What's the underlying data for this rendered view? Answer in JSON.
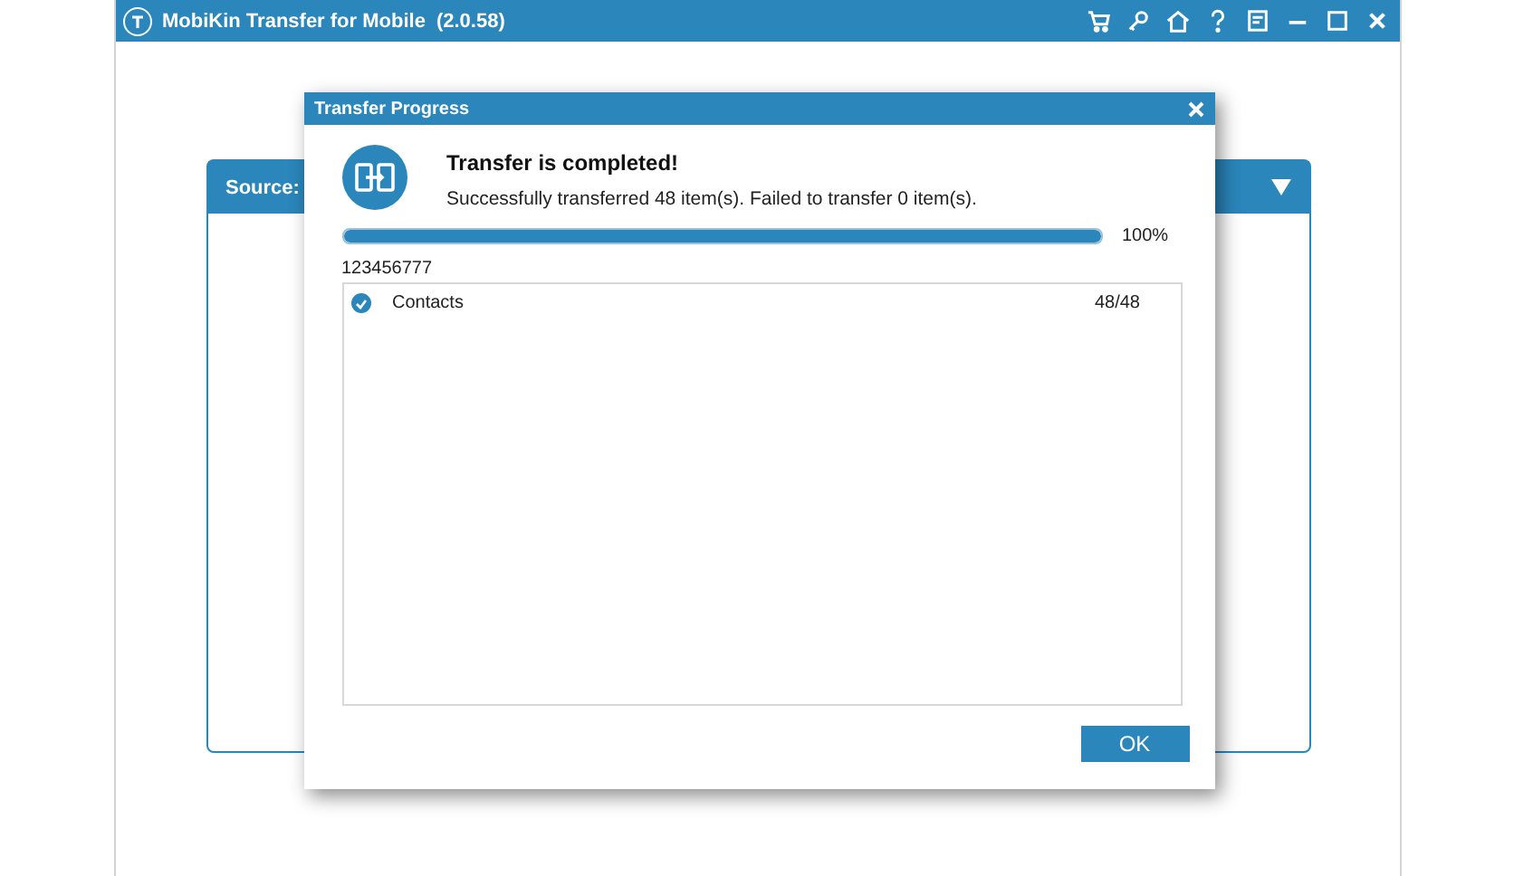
{
  "window": {
    "title": "MobiKin Transfer for Mobile",
    "version": "(2.0.58)"
  },
  "source_panel": {
    "label": "Source:"
  },
  "dialog": {
    "title": "Transfer Progress",
    "heading": "Transfer is completed!",
    "message": "Successfully transferred 48 item(s). Failed to transfer 0 item(s).",
    "progress": {
      "level": 1,
      "reading": "100%"
    },
    "device": "123456777",
    "items": [
      {
        "name": "Contacts",
        "count": "48/48",
        "checked": true
      }
    ],
    "buttons": [
      "OK"
    ]
  }
}
